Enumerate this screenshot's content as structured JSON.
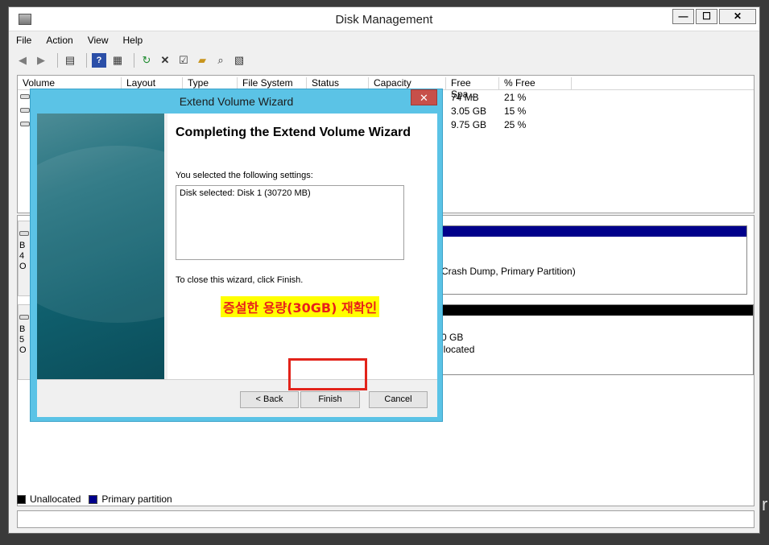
{
  "window": {
    "title": "Disk Management"
  },
  "menu": [
    "File",
    "Action",
    "View",
    "Help"
  ],
  "toolbar_icons": [
    "back-icon",
    "forward-icon",
    "console-tree-icon",
    "help-icon",
    "properties-view-icon",
    "refresh-icon",
    "delete-icon",
    "properties-icon",
    "open-icon",
    "search-icon",
    "export-icon"
  ],
  "volume_list": {
    "columns": [
      "Volume",
      "Layout",
      "Type",
      "File System",
      "Status",
      "Capacity",
      "Free Spa...",
      "% Free"
    ],
    "rows": [
      {
        "free": "74 MB",
        "pct": "21 %"
      },
      {
        "free": "3.05 GB",
        "pct": "15 %"
      },
      {
        "free": "9.75 GB",
        "pct": "25 %"
      }
    ]
  },
  "disk_map": {
    "disk0": {
      "letter_lines": [
        "B",
        "4",
        "O"
      ],
      "partition_text": "Crash Dump, Primary Partition)",
      "bar_color": "#00008b"
    },
    "disk1": {
      "letter_lines": [
        "B",
        "5",
        "O"
      ],
      "partition_size": "0 GB",
      "partition_status": "llocated",
      "bar_color": "#000000"
    }
  },
  "legend": [
    {
      "label": "Unallocated",
      "color": "#000000"
    },
    {
      "label": "Primary partition",
      "color": "#00008b"
    }
  ],
  "wizard": {
    "title": "Extend Volume Wizard",
    "close_glyph": "✕",
    "heading": "Completing the Extend Volume Wizard",
    "settings_label": "You selected the following settings:",
    "settings_text": "Disk selected: Disk 1 (30720 MB)",
    "close_instruction": "To close this wizard, click Finish.",
    "annotation": "증설한 용량(30GB) 재확인",
    "buttons": {
      "back": "< Back",
      "finish": "Finish",
      "cancel": "Cancel"
    }
  },
  "edge_char": "r",
  "colors": {
    "wizard_frame": "#5bc3e6",
    "annotation_bg": "#ffff00",
    "annotation_text": "#e8201a",
    "highlight": "#e2231a"
  }
}
